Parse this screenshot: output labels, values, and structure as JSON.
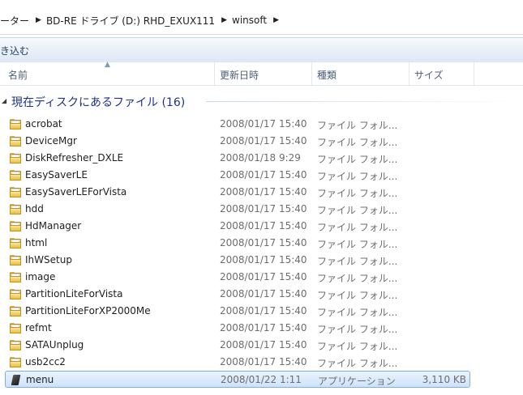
{
  "breadcrumb": [
    {
      "label": "ーター"
    },
    {
      "label": "BD-RE ドライブ (D:) RHD_EXUX111"
    },
    {
      "label": "winsoft"
    }
  ],
  "toolbar": {
    "burn_label": "き込む"
  },
  "columns": {
    "name": "名前",
    "date": "更新日時",
    "type": "種類",
    "size": "サイズ"
  },
  "group": {
    "title": "現在ディスクにあるファイル (16)"
  },
  "files": [
    {
      "name": "acrobat",
      "date": "2008/01/17 15:40",
      "type": "ファイル フォル...",
      "size": "",
      "icon": "folder-icon"
    },
    {
      "name": "DeviceMgr",
      "date": "2008/01/17 15:40",
      "type": "ファイル フォル...",
      "size": "",
      "icon": "folder-icon"
    },
    {
      "name": "DiskRefresher_DXLE",
      "date": "2008/01/18 9:29",
      "type": "ファイル フォル...",
      "size": "",
      "icon": "folder-icon"
    },
    {
      "name": "EasySaverLE",
      "date": "2008/01/17 15:40",
      "type": "ファイル フォル...",
      "size": "",
      "icon": "folder-icon"
    },
    {
      "name": "EasySaverLEForVista",
      "date": "2008/01/17 15:40",
      "type": "ファイル フォル...",
      "size": "",
      "icon": "folder-icon"
    },
    {
      "name": "hdd",
      "date": "2008/01/17 15:40",
      "type": "ファイル フォル...",
      "size": "",
      "icon": "folder-icon"
    },
    {
      "name": "HdManager",
      "date": "2008/01/17 15:40",
      "type": "ファイル フォル...",
      "size": "",
      "icon": "folder-icon"
    },
    {
      "name": "html",
      "date": "2008/01/17 15:40",
      "type": "ファイル フォル...",
      "size": "",
      "icon": "folder-icon"
    },
    {
      "name": "IhWSetup",
      "date": "2008/01/17 15:40",
      "type": "ファイル フォル...",
      "size": "",
      "icon": "folder-icon"
    },
    {
      "name": "image",
      "date": "2008/01/17 15:40",
      "type": "ファイル フォル...",
      "size": "",
      "icon": "folder-icon"
    },
    {
      "name": "PartitionLiteForVista",
      "date": "2008/01/17 15:40",
      "type": "ファイル フォル...",
      "size": "",
      "icon": "folder-icon"
    },
    {
      "name": "PartitionLiteForXP2000Me",
      "date": "2008/01/17 15:40",
      "type": "ファイル フォル...",
      "size": "",
      "icon": "folder-icon"
    },
    {
      "name": "refmt",
      "date": "2008/01/17 15:40",
      "type": "ファイル フォル...",
      "size": "",
      "icon": "folder-icon"
    },
    {
      "name": "SATAUnplug",
      "date": "2008/01/17 15:40",
      "type": "ファイル フォル...",
      "size": "",
      "icon": "folder-icon"
    },
    {
      "name": "usb2cc2",
      "date": "2008/01/17 15:40",
      "type": "ファイル フォル...",
      "size": "",
      "icon": "folder-icon"
    },
    {
      "name": "menu",
      "date": "2008/01/22 1:11",
      "type": "アプリケーション",
      "size": "3,110 KB",
      "icon": "application-icon",
      "selected": true
    }
  ],
  "colors": {
    "accent": "#1e3287",
    "selection": "#cde3fb",
    "selection_border": "#84acdd"
  }
}
